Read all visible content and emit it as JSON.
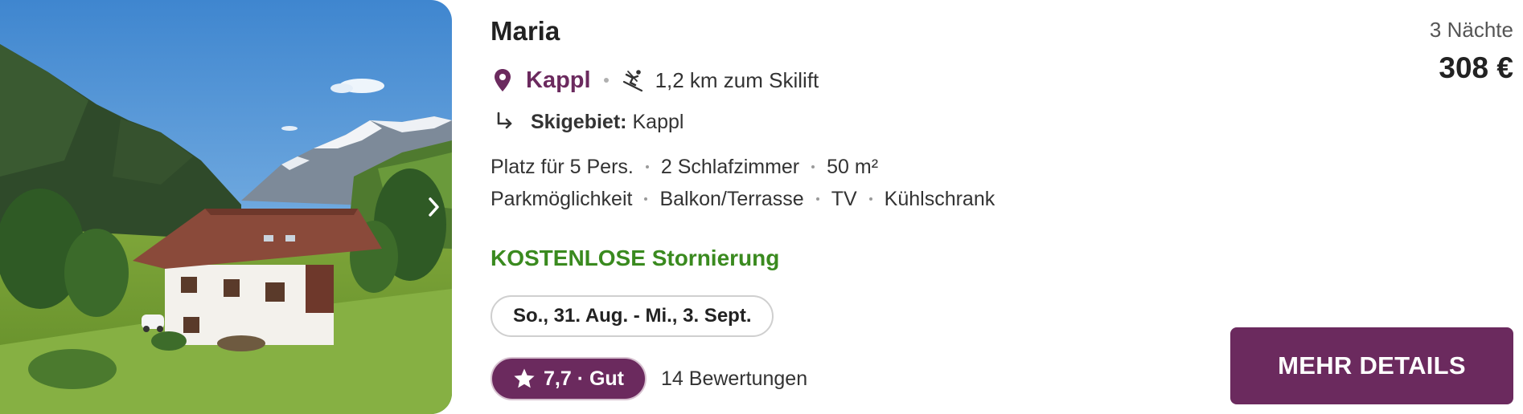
{
  "listing": {
    "name": "Maria",
    "location": "Kappl",
    "distance": "1,2 km zum Skilift",
    "resort_label": "Skigebiet:",
    "resort_name": "Kappl",
    "features_row1": [
      "Platz für 5 Pers.",
      "2 Schlafzimmer",
      "50 m²"
    ],
    "features_row2": [
      "Parkmöglichkeit",
      "Balkon/Terrasse",
      "TV",
      "Kühlschrank"
    ],
    "cancellation": "KOSTENLOSE Stornierung",
    "dates": "So., 31. Aug. - Mi., 3. Sept.",
    "rating": "7,7 · Gut",
    "reviews": "14 Bewertungen"
  },
  "pricing": {
    "nights": "3 Nächte",
    "price": "308 €"
  },
  "actions": {
    "details_button": "MEHR DETAILS"
  },
  "icons": {
    "location": "map-pin-icon",
    "ski": "skier-icon",
    "resort": "subdirectory-arrow-icon",
    "rating": "star-icon",
    "gallery_next": "chevron-right-icon"
  },
  "colors": {
    "brand": "#6b2a5e",
    "cancellation": "#3a8a1f"
  }
}
